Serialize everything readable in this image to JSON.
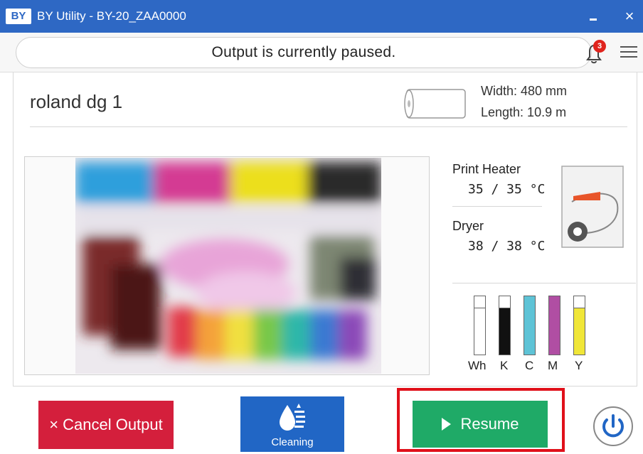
{
  "window": {
    "logo": "BY",
    "title": "BY Utility - BY-20_ZAA0000",
    "minimize_icon": "minimize-icon",
    "close_label": "×"
  },
  "status": {
    "message": "Output is currently paused.",
    "notification_count": "3"
  },
  "printer": {
    "name": "roland dg 1"
  },
  "media": {
    "width": "Width: 480 mm",
    "length": "Length: 10.9 m"
  },
  "heaters": {
    "print_heater_label": "Print Heater",
    "print_heater_value": "35 / 35 °C",
    "dryer_label": "Dryer",
    "dryer_value": "38 / 38 °C"
  },
  "inks": [
    {
      "label": "Wh",
      "color": "#ffffff",
      "level": 0.81
    },
    {
      "label": "K",
      "color": "#111111",
      "level": 0.81
    },
    {
      "label": "C",
      "color": "#5ec3d6",
      "level": 1.0
    },
    {
      "label": "M",
      "color": "#b04ea3",
      "level": 1.0
    },
    {
      "label": "Y",
      "color": "#f0e638",
      "level": 0.81
    }
  ],
  "actions": {
    "cancel_label": "Cancel Output",
    "cancel_icon": "×",
    "cleaning_label": "Cleaning",
    "resume_label": "Resume"
  },
  "colors": {
    "titlebar": "#2e68c4",
    "cancel": "#d41f3c",
    "cleaning": "#2166c5",
    "resume": "#1faa67",
    "highlight": "#e0101a"
  }
}
